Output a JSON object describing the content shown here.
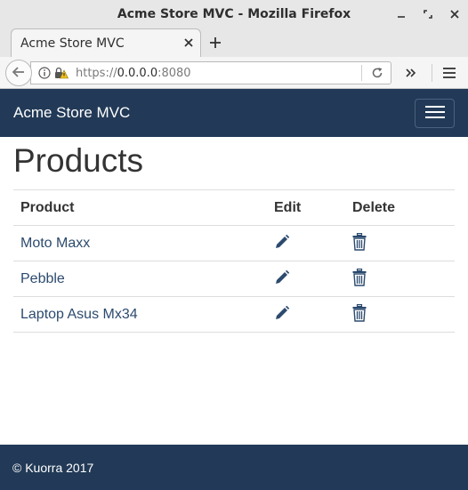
{
  "window": {
    "title": "Acme Store MVC - Mozilla Firefox"
  },
  "browser": {
    "tab_label": "Acme Store MVC",
    "url_scheme": "https://",
    "url_host": "0.0.0.0",
    "url_port": ":8080"
  },
  "site": {
    "brand": "Acme Store MVC",
    "page_title": "Products",
    "table": {
      "headers": [
        "Product",
        "Edit",
        "Delete"
      ],
      "rows": [
        {
          "product": "Moto Maxx"
        },
        {
          "product": "Pebble"
        },
        {
          "product": "Laptop Asus Mx34"
        }
      ]
    },
    "footer": "© Kuorra 2017"
  },
  "colors": {
    "navbar_bg": "#223a57",
    "link": "#2c4a6e"
  },
  "icons": {
    "edit": "pencil-icon",
    "delete": "trash-icon"
  }
}
